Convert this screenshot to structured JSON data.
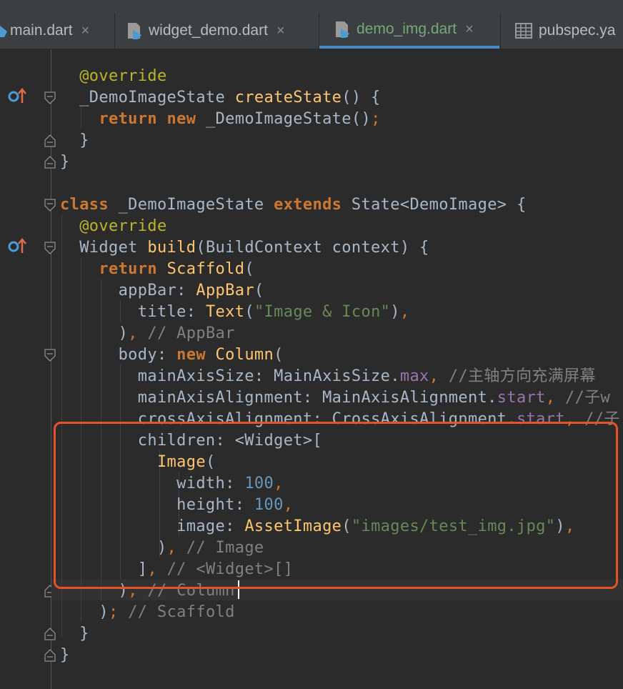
{
  "tabs": [
    {
      "label": "main.dart",
      "close": "×"
    },
    {
      "label": "widget_demo.dart",
      "close": "×"
    },
    {
      "label": "demo_img.dart",
      "close": "×",
      "active": true
    },
    {
      "label": "pubspec.ya",
      "close": ""
    }
  ],
  "colors": {
    "keyword": "#cc7832",
    "annotation": "#bbb529",
    "function": "#ffc66d",
    "string": "#6a8759",
    "number": "#6897bb",
    "comment": "#808080",
    "highlight_box": "#e8512a",
    "active_tab": "#74a77c"
  },
  "icons": {
    "dart_file": "dart-file-icon",
    "yaml_file": "table-file-icon",
    "override_marker": "override-method-icon",
    "fold": "fold-icon"
  },
  "code": {
    "lines": [
      [
        {
          "t": "  "
        },
        {
          "t": "@override",
          "c": "ann"
        }
      ],
      [
        {
          "t": "  _DemoImageState "
        },
        {
          "t": "createState",
          "c": "fn"
        },
        {
          "t": "() {"
        }
      ],
      [
        {
          "t": "    "
        },
        {
          "t": "return new ",
          "c": "kw"
        },
        {
          "t": "_DemoImageState()"
        },
        {
          "t": ";",
          "c": "pn"
        }
      ],
      [
        {
          "t": "  }"
        }
      ],
      [
        {
          "t": "}"
        }
      ],
      [
        {
          "t": ""
        }
      ],
      [
        {
          "t": "class ",
          "c": "kw"
        },
        {
          "t": "_DemoImageState "
        },
        {
          "t": "extends ",
          "c": "kw"
        },
        {
          "t": "State<DemoImage> {"
        }
      ],
      [
        {
          "t": "  "
        },
        {
          "t": "@override",
          "c": "ann"
        }
      ],
      [
        {
          "t": "  Widget "
        },
        {
          "t": "build",
          "c": "fn"
        },
        {
          "t": "(BuildContext context) {"
        }
      ],
      [
        {
          "t": "    "
        },
        {
          "t": "return ",
          "c": "kw"
        },
        {
          "t": "Scaffold",
          "c": "fn"
        },
        {
          "t": "("
        }
      ],
      [
        {
          "t": "      appBar: "
        },
        {
          "t": "AppBar",
          "c": "fn"
        },
        {
          "t": "("
        }
      ],
      [
        {
          "t": "        title: "
        },
        {
          "t": "Text",
          "c": "fn"
        },
        {
          "t": "("
        },
        {
          "t": "\"Image & Icon\"",
          "c": "str"
        },
        {
          "t": ")"
        },
        {
          "t": ",",
          "c": "pn"
        }
      ],
      [
        {
          "t": "      )"
        },
        {
          "t": ", ",
          "c": "pn"
        },
        {
          "t": "// AppBar",
          "c": "cmt"
        }
      ],
      [
        {
          "t": "      body: "
        },
        {
          "t": "new ",
          "c": "kw"
        },
        {
          "t": "Column",
          "c": "fn"
        },
        {
          "t": "("
        }
      ],
      [
        {
          "t": "        mainAxisSize: MainAxisSize."
        },
        {
          "t": "max",
          "c": "prop"
        },
        {
          "t": ", ",
          "c": "pn"
        },
        {
          "t": "//主轴方向充满屏幕",
          "c": "cmt"
        }
      ],
      [
        {
          "t": "        mainAxisAlignment: MainAxisAlignment."
        },
        {
          "t": "start",
          "c": "prop"
        },
        {
          "t": ", ",
          "c": "pn"
        },
        {
          "t": "//子w",
          "c": "cmt"
        }
      ],
      [
        {
          "t": "        crossAxisAlignment: CrossAxisAlignment."
        },
        {
          "t": "start",
          "c": "prop"
        },
        {
          "t": ", ",
          "c": "pn"
        },
        {
          "t": "//子",
          "c": "cmt"
        }
      ],
      [
        {
          "t": "        children: <Widget>["
        }
      ],
      [
        {
          "t": "          "
        },
        {
          "t": "Image",
          "c": "fn"
        },
        {
          "t": "("
        }
      ],
      [
        {
          "t": "            width: "
        },
        {
          "t": "100",
          "c": "num"
        },
        {
          "t": ",",
          "c": "pn"
        }
      ],
      [
        {
          "t": "            height: "
        },
        {
          "t": "100",
          "c": "num"
        },
        {
          "t": ",",
          "c": "pn"
        }
      ],
      [
        {
          "t": "            image: "
        },
        {
          "t": "AssetImage",
          "c": "fn"
        },
        {
          "t": "("
        },
        {
          "t": "\"images/test_img.jpg\"",
          "c": "str"
        },
        {
          "t": ")"
        },
        {
          "t": ",",
          "c": "pn"
        }
      ],
      [
        {
          "t": "          )"
        },
        {
          "t": ", ",
          "c": "pn"
        },
        {
          "t": "// Image",
          "c": "cmt"
        }
      ],
      [
        {
          "t": "        ]"
        },
        {
          "t": ", ",
          "c": "pn"
        },
        {
          "t": "// <Widget>[]",
          "c": "cmt"
        }
      ],
      [
        {
          "t": "      )"
        },
        {
          "t": ", ",
          "c": "pn"
        },
        {
          "t": "// Column",
          "c": "cmt"
        }
      ],
      [
        {
          "t": "    )"
        },
        {
          "t": "; ",
          "c": "pn"
        },
        {
          "t": "// Scaffold",
          "c": "cmt"
        }
      ],
      [
        {
          "t": "  }"
        }
      ],
      [
        {
          "t": "}"
        }
      ]
    ]
  }
}
